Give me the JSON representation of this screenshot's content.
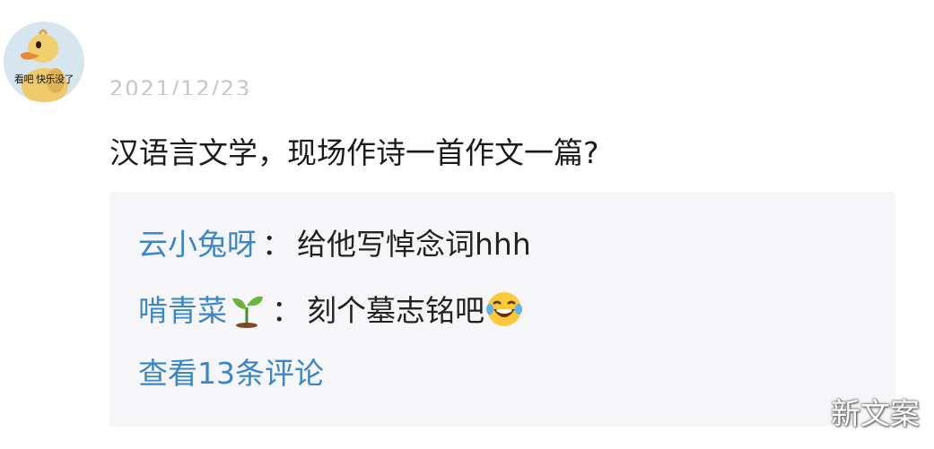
{
  "avatar": {
    "icon": "duck-cartoon-avatar",
    "caption": "看吧 快乐没了"
  },
  "post": {
    "timestamp": "2021/12/23",
    "text": "汉语言文学，现场作诗一首作文一篇?"
  },
  "comments": [
    {
      "user": "云小兔呀",
      "separator": "：",
      "text": "给他写悼念词hhh"
    },
    {
      "user": "啃青菜",
      "user_emoji": "seedling-icon",
      "separator": "：",
      "text": "刻个墓志铭吧",
      "trailing_emoji": "laughing-tears-emoji"
    }
  ],
  "view_more": "查看13条评论",
  "watermark": "新文案",
  "colors": {
    "link_blue": "#3a86c8",
    "box_background": "#f6f6f8",
    "text_dark": "#1b1b1b"
  }
}
